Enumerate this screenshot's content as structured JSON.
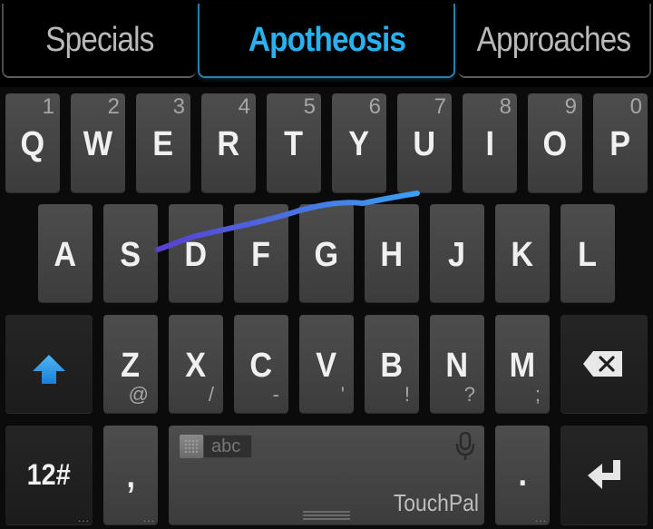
{
  "candidates": [
    {
      "label": "Specials",
      "active": false
    },
    {
      "label": "Apotheosis",
      "active": true
    },
    {
      "label": "Approaches",
      "active": false
    }
  ],
  "rows": {
    "row1": [
      {
        "label": "Q",
        "num": "1"
      },
      {
        "label": "W",
        "num": "2"
      },
      {
        "label": "E",
        "num": "3"
      },
      {
        "label": "R",
        "num": "4"
      },
      {
        "label": "T",
        "num": "5"
      },
      {
        "label": "Y",
        "num": "6"
      },
      {
        "label": "U",
        "num": "7"
      },
      {
        "label": "I",
        "num": "8"
      },
      {
        "label": "O",
        "num": "9"
      },
      {
        "label": "P",
        "num": "0"
      }
    ],
    "row2": [
      {
        "label": "A"
      },
      {
        "label": "S"
      },
      {
        "label": "D"
      },
      {
        "label": "F"
      },
      {
        "label": "G"
      },
      {
        "label": "H"
      },
      {
        "label": "J"
      },
      {
        "label": "K"
      },
      {
        "label": "L"
      }
    ],
    "row3": [
      {
        "label": "Z",
        "sub": "@"
      },
      {
        "label": "X",
        "sub": "/"
      },
      {
        "label": "C",
        "sub": "-"
      },
      {
        "label": "V",
        "sub": "'"
      },
      {
        "label": "B",
        "sub": "!"
      },
      {
        "label": "N",
        "sub": "?"
      },
      {
        "label": "M",
        "sub": ";"
      }
    ]
  },
  "bottom": {
    "symbols_label": "12#",
    "comma_label": ",",
    "period_label": ".",
    "more_indicator": "...",
    "space": {
      "language_label": "abc",
      "brand_label": "TouchPal"
    }
  },
  "icons": {
    "shift": "shift-arrow-up-icon",
    "backspace": "backspace-icon",
    "enter": "enter-return-icon",
    "mic": "microphone-icon",
    "grid": "layout-grid-icon"
  },
  "colors": {
    "accent": "#29b0ee",
    "swipe_start": "#5a3fd0",
    "swipe_end": "#3aa0f5",
    "key_bg": "#454545",
    "function_key_bg": "#212121"
  },
  "swipe_trail": {
    "keys_traced": [
      "S",
      "D",
      "F",
      "G",
      "Y",
      "U"
    ]
  }
}
